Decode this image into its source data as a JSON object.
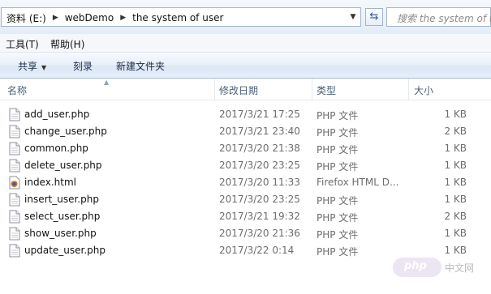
{
  "address": {
    "crumbs": [
      "资料 (E:)",
      "webDemo",
      "the system of user"
    ],
    "search_placeholder": "搜索 the system of user"
  },
  "menu": {
    "tools": "工具(T)",
    "help": "帮助(H)"
  },
  "toolbar": {
    "share": "共享",
    "burn": "刻录",
    "new_folder": "新建文件夹"
  },
  "columns": {
    "name": "名称",
    "date": "修改日期",
    "type": "类型",
    "size": "大小"
  },
  "files": [
    {
      "name": "add_user.php",
      "date": "2017/3/21 17:25",
      "type": "PHP 文件",
      "size": "1 KB",
      "icon": "php-file-icon"
    },
    {
      "name": "change_user.php",
      "date": "2017/3/21 23:40",
      "type": "PHP 文件",
      "size": "2 KB",
      "icon": "php-file-icon"
    },
    {
      "name": "common.php",
      "date": "2017/3/20 21:38",
      "type": "PHP 文件",
      "size": "1 KB",
      "icon": "php-file-icon"
    },
    {
      "name": "delete_user.php",
      "date": "2017/3/20 23:25",
      "type": "PHP 文件",
      "size": "1 KB",
      "icon": "php-file-icon"
    },
    {
      "name": "index.html",
      "date": "2017/3/20 11:33",
      "type": "Firefox HTML D...",
      "size": "1 KB",
      "icon": "firefox-html-icon"
    },
    {
      "name": "insert_user.php",
      "date": "2017/3/20 23:25",
      "type": "PHP 文件",
      "size": "1 KB",
      "icon": "php-file-icon"
    },
    {
      "name": "select_user.php",
      "date": "2017/3/21 19:32",
      "type": "PHP 文件",
      "size": "2 KB",
      "icon": "php-file-icon"
    },
    {
      "name": "show_user.php",
      "date": "2017/3/20 21:36",
      "type": "PHP 文件",
      "size": "1 KB",
      "icon": "php-file-icon"
    },
    {
      "name": "update_user.php",
      "date": "2017/3/22 0:14",
      "type": "PHP 文件",
      "size": "1 KB",
      "icon": "php-file-icon"
    }
  ],
  "watermark": {
    "brand": "php",
    "site": "中文网"
  }
}
